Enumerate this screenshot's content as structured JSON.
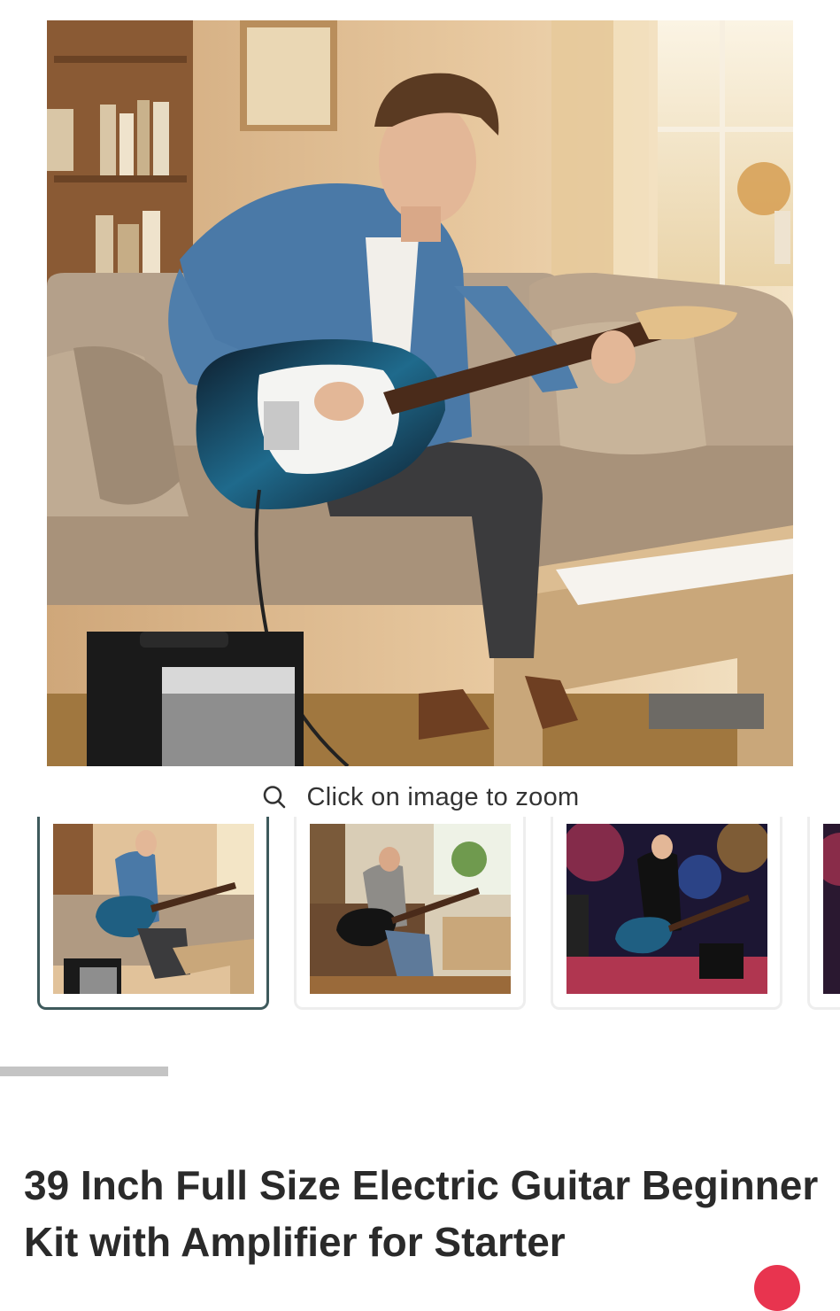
{
  "gallery": {
    "main_image": {
      "scene": "guitar-player-living-room",
      "icon": "product-photo"
    },
    "zoom_hint": {
      "icon": "search-icon",
      "text": "Click on image to zoom"
    },
    "thumbnails": [
      {
        "scene": "guitar-player-living-room",
        "active": true
      },
      {
        "scene": "guitar-player-cozy-room",
        "active": false
      },
      {
        "scene": "guitar-player-concert-stage",
        "active": false
      },
      {
        "scene": "partial-thumbnail",
        "active": false
      }
    ],
    "scroll_progress": 0.2
  },
  "product": {
    "title": "39 Inch Full Size Electric Guitar Beginner Kit with Amplifier for Starter"
  },
  "colors": {
    "active_thumb_border": "#3e5a5c",
    "scroll_indicator": "#c4c4c4",
    "badge": "#e8344f"
  }
}
